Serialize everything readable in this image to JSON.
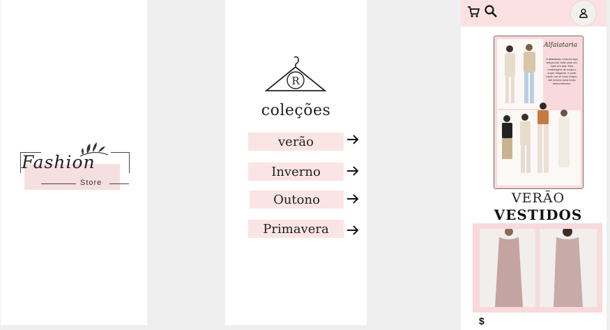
{
  "logo": {
    "word": "Fashion",
    "sub": "Store"
  },
  "collections": {
    "title": "coleções",
    "hanger_letter": "R",
    "items": [
      {
        "label": "verão"
      },
      {
        "label": "Inverno"
      },
      {
        "label": "Outono"
      },
      {
        "label": "Primavera"
      }
    ]
  },
  "mobile": {
    "icons": [
      "cart-icon",
      "search-icon",
      "user-icon"
    ],
    "lookbook": {
      "title": "Alfaiataria",
      "text": "A alfaiataria, embora seja tempo-rial, está cada vez mais em alta. Esta modelagem de roupa é super elegante, e pode trazer um ar mais chique, até mesmo para looks descontraídos."
    },
    "season_label": "VERÃO",
    "category_label": "VESTIDOS",
    "price_icon": "$"
  },
  "colors": {
    "accent_pink": "#fbe4e4",
    "background": "#efefef",
    "text": "#1f1f1f"
  }
}
